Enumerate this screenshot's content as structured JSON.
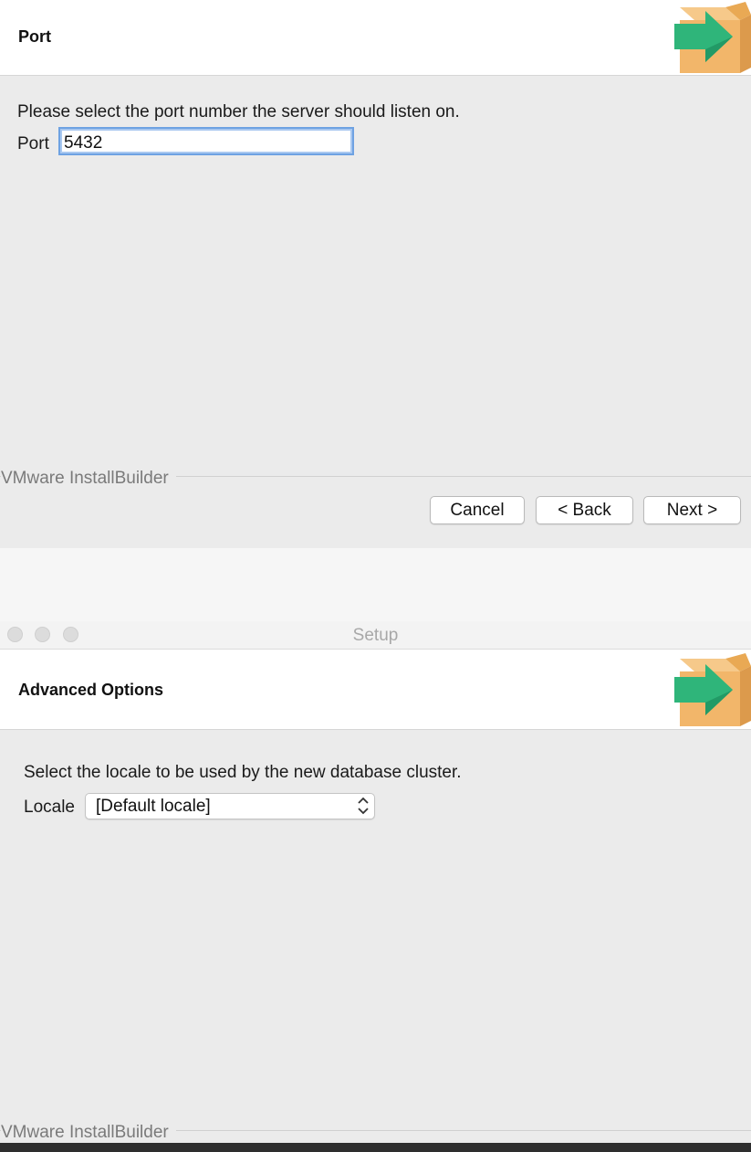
{
  "window": {
    "title": "Setup"
  },
  "port_page": {
    "title": "Port",
    "instruction": "Please select the port number the server should listen on.",
    "port_label": "Port",
    "port_value": "5432",
    "brand": "VMware InstallBuilder",
    "buttons": {
      "cancel": "Cancel",
      "back": "< Back",
      "next": "Next >"
    }
  },
  "advanced_page": {
    "title": "Advanced Options",
    "instruction": "Select the locale to be used by the new database cluster.",
    "locale_label": "Locale",
    "locale_value": "[Default locale]",
    "brand": "VMware InstallBuilder"
  },
  "icons": {
    "logo": "installer-box-arrow-icon",
    "select": "chevron-up-down-icon"
  },
  "colors": {
    "focus_ring": "#6ea2e2",
    "box": "#f2b66a",
    "arrow": "#2fb57a"
  }
}
